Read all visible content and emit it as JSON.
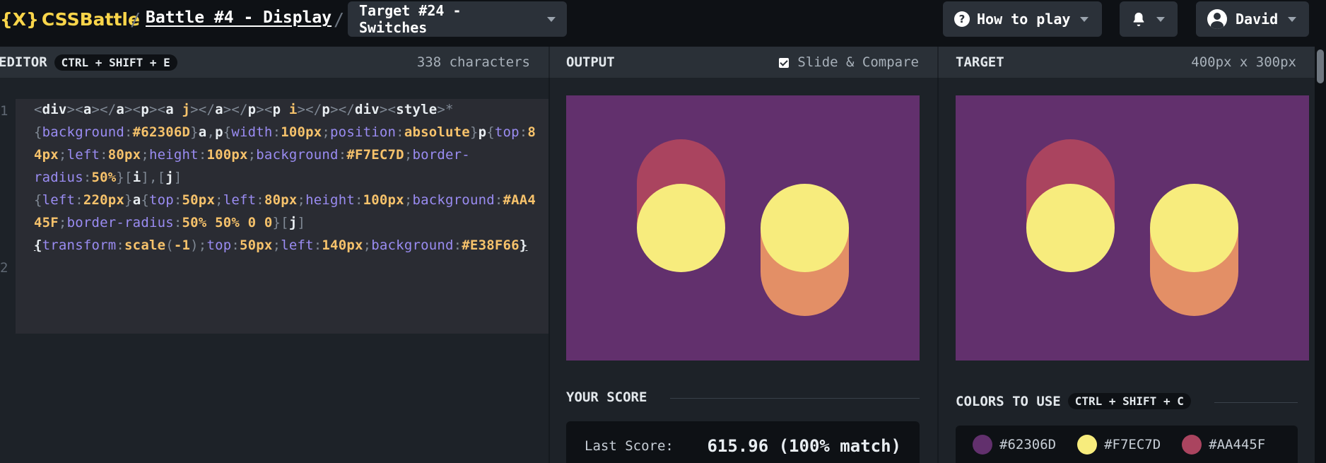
{
  "header": {
    "logo_mark": "{X}",
    "logo_text": "CSSBattle",
    "separator": "/",
    "battle": "Battle #4 - Display",
    "target": "Target #24 - Switches",
    "how_to_play": "How to play",
    "user": "David"
  },
  "editor": {
    "title": "EDITOR",
    "shortcut": "CTRL + SHIFT + E",
    "char_count": "338 characters",
    "line_numbers": [
      "1",
      "2"
    ]
  },
  "output": {
    "title": "OUTPUT",
    "slide_compare": "Slide & Compare",
    "slide_compare_checked": true
  },
  "target": {
    "title": "TARGET",
    "size": "400px x 300px"
  },
  "score": {
    "title": "YOUR SCORE",
    "last_label": "Last Score:",
    "last_value": "615.96 (100% match)"
  },
  "colors": {
    "title": "COLORS TO USE",
    "shortcut": "CTRL + SHIFT + C",
    "items": [
      {
        "hex": "#62306D",
        "label": "#62306D"
      },
      {
        "hex": "#F7EC7D",
        "label": "#F7EC7D"
      },
      {
        "hex": "#AA445F",
        "label": "#AA445F"
      }
    ]
  },
  "palette": {
    "bg": "#62306d",
    "yellow": "#f7ec7d",
    "red": "#aa445f",
    "orange": "#e38f66",
    "accent": "#f9d54a"
  }
}
